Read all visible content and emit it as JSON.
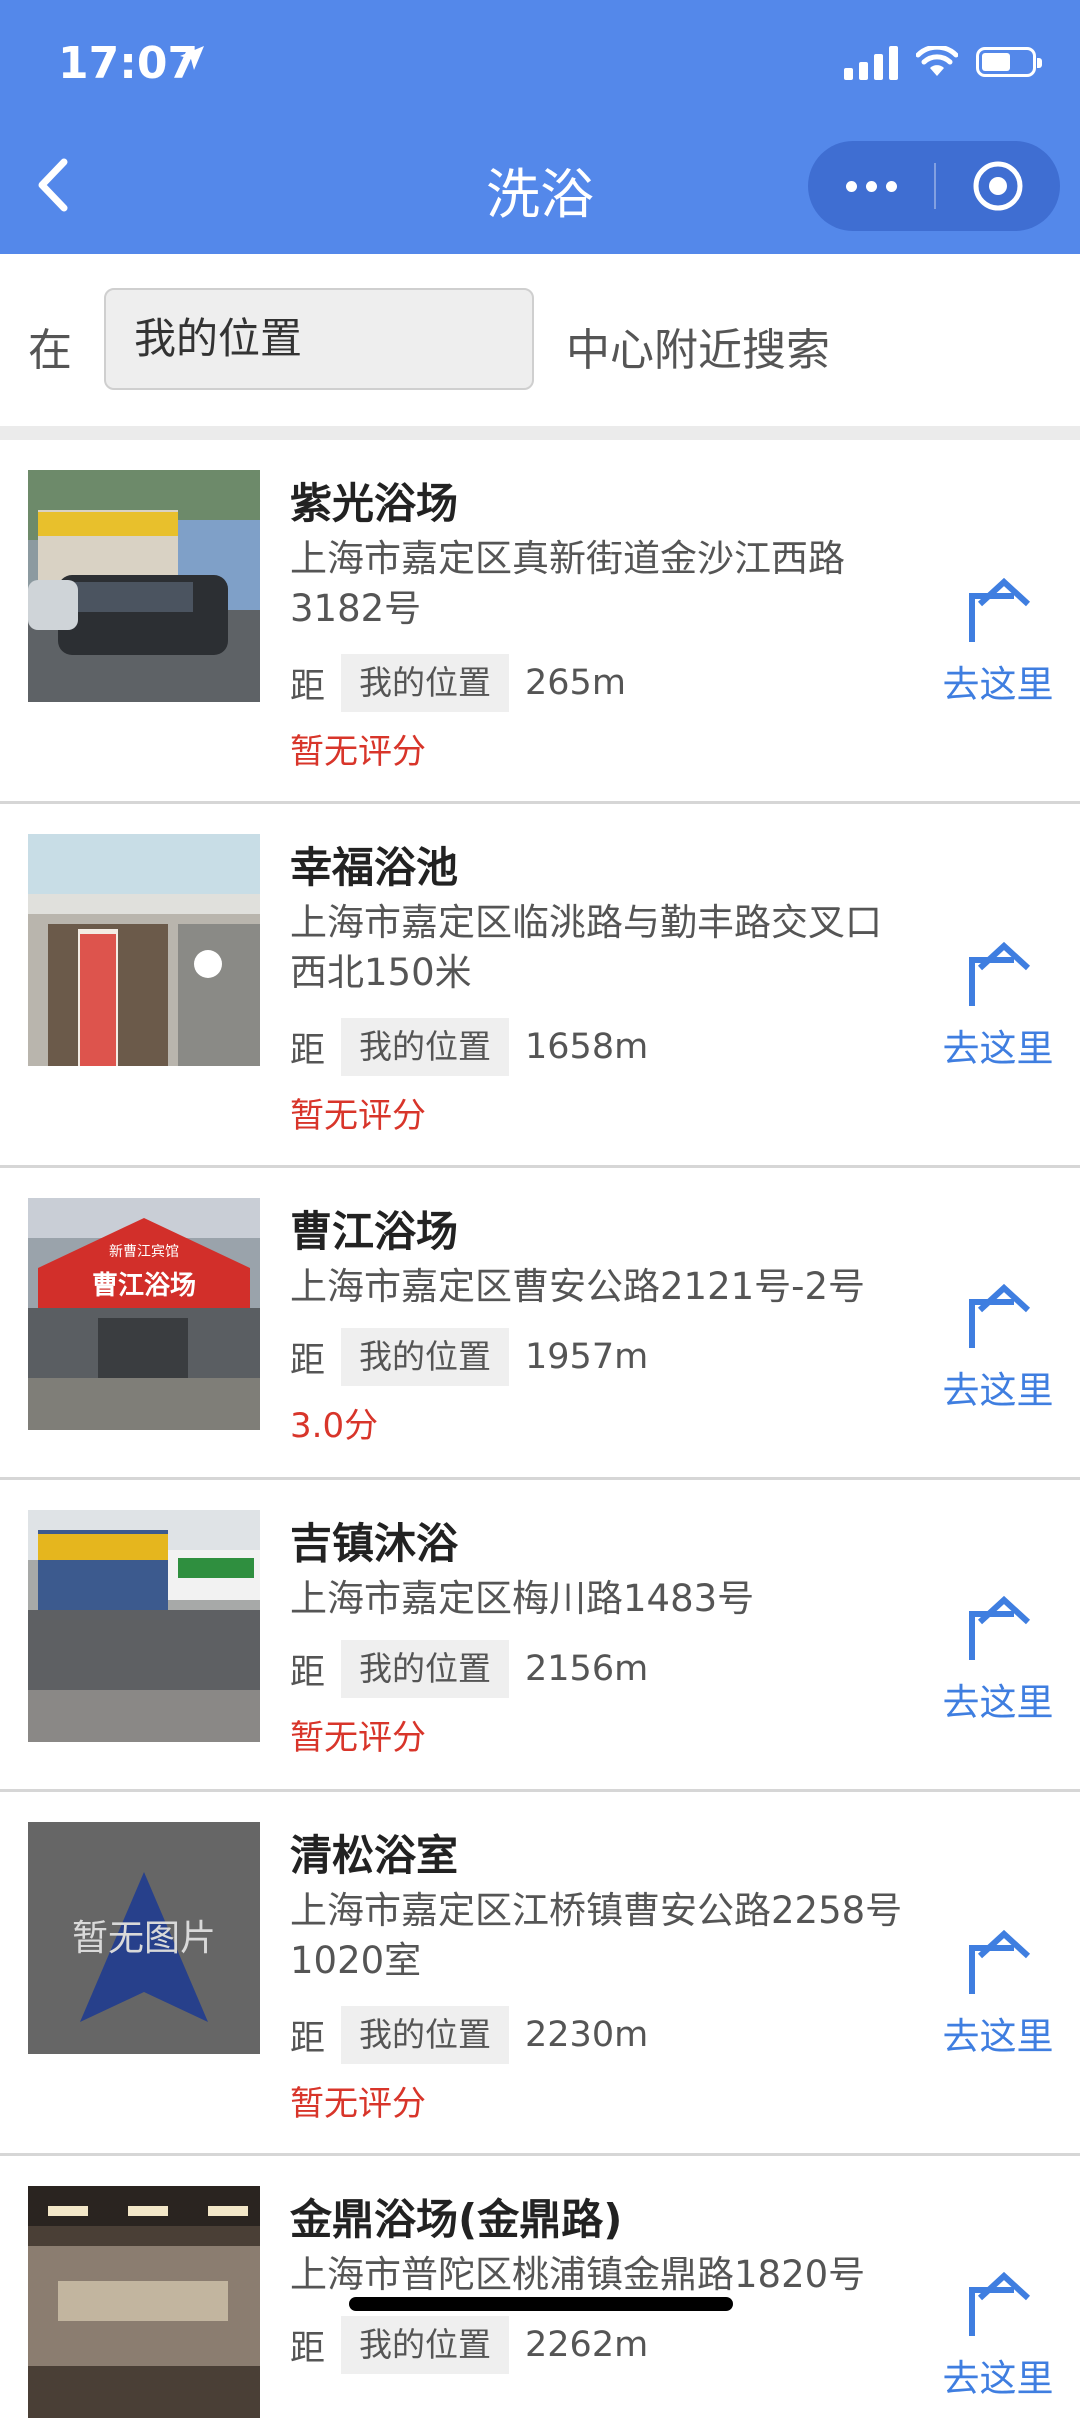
{
  "status_bar": {
    "time": "17:07"
  },
  "header": {
    "title": "洗浴"
  },
  "search": {
    "prefix": "在",
    "location_value": "我的位置",
    "suffix": "中心附近搜索"
  },
  "list": {
    "items": [
      {
        "name": "紫光浴场",
        "address": "上海市嘉定区真新街道金沙江西路3182号",
        "distance_prefix": "距",
        "distance_ref": "我的位置",
        "distance": "265m",
        "rating": "暂无评分",
        "goto_label": "去这里"
      },
      {
        "name": "幸福浴池",
        "address": "上海市嘉定区临洮路与勤丰路交叉口西北150米",
        "distance_prefix": "距",
        "distance_ref": "我的位置",
        "distance": "1658m",
        "rating": "暂无评分",
        "goto_label": "去这里"
      },
      {
        "name": "曹江浴场",
        "address": "上海市嘉定区曹安公路2121号-2号",
        "distance_prefix": "距",
        "distance_ref": "我的位置",
        "distance": "1957m",
        "rating": "3.0分",
        "goto_label": "去这里",
        "photo_sign": "曹江浴场",
        "photo_sign_top": "新曹江宾馆"
      },
      {
        "name": "吉镇沐浴",
        "address": "上海市嘉定区梅川路1483号",
        "distance_prefix": "距",
        "distance_ref": "我的位置",
        "distance": "2156m",
        "rating": "暂无评分",
        "goto_label": "去这里"
      },
      {
        "name": "清松浴室",
        "address": "上海市嘉定区江桥镇曹安公路2258号1020室",
        "distance_prefix": "距",
        "distance_ref": "我的位置",
        "distance": "2230m",
        "rating": "暂无评分",
        "goto_label": "去这里",
        "placeholder_text": "暂无图片"
      },
      {
        "name": "金鼎浴场(金鼎路)",
        "address": "上海市普陀区桃浦镇金鼎路1820号",
        "distance_prefix": "距",
        "distance_ref": "我的位置",
        "distance": "2262m",
        "goto_label": "去这里"
      }
    ]
  },
  "colors": {
    "header_bg": "#5488ea",
    "accent_link": "#3f7ee0",
    "rating_red": "#d8352a"
  }
}
